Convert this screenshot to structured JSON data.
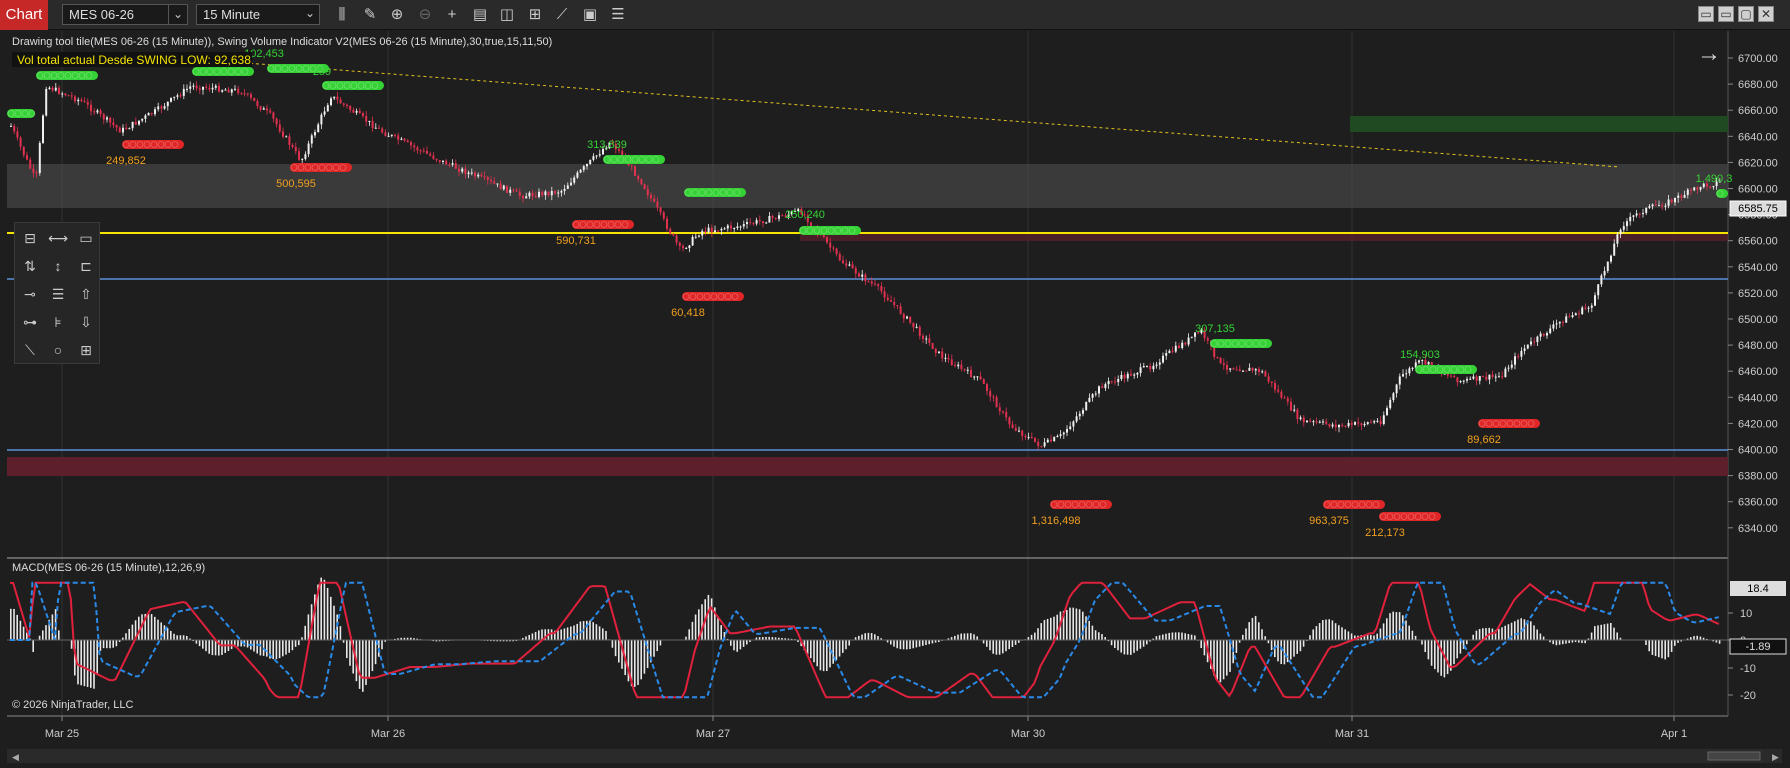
{
  "toolbar": {
    "chart_tab": "Chart",
    "instrument": "MES 06-26",
    "interval": "15 Minute",
    "window_buttons": [
      "▭",
      "▭",
      "▢",
      "✕"
    ]
  },
  "indicator_line": "Drawing tool tile(MES 06-26 (15 Minute)), Swing Volume Indicator V2(MES 06-26 (15 Minute),30,true,15,11,50)",
  "vol_label": "Vol total actual Desde SWING LOW: 92,638",
  "macd_title": "MACD(MES 06-26 (15 Minute),12,26,9)",
  "copyright": "© 2026 NinjaTrader, LLC",
  "price_axis": {
    "ticks": [
      "6700.00",
      "6680.00",
      "6660.00",
      "6640.00",
      "6620.00",
      "6600.00",
      "6580.00",
      "6560.00",
      "6540.00",
      "6520.00",
      "6500.00",
      "6480.00",
      "6460.00",
      "6440.00",
      "6420.00",
      "6400.00",
      "6380.00",
      "6360.00",
      "6340.00"
    ],
    "current_price": "6585.75"
  },
  "macd_axis": {
    "ticks": [
      "10",
      "0",
      "-10",
      "-20"
    ],
    "macd_value": "18.4",
    "hist_value": "-1.89"
  },
  "time_axis": [
    "Mar 25",
    "Mar 26",
    "Mar 27",
    "Mar 30",
    "Mar 31",
    "Apr 1"
  ],
  "swing_labels": {
    "highs": [
      "102,453",
      "259",
      "313,839",
      "250,240",
      "307,135",
      "154,903",
      "1,490,3"
    ],
    "lows": [
      "249,852",
      "500,595",
      "590,731",
      "60,418",
      "1,316,498",
      "963,375",
      "212,173",
      "89,662"
    ]
  },
  "colors": {
    "background": "#1e1e1e",
    "up_candle": "#f0f0f0",
    "down_candle": "#e0314f",
    "swing_high": "#35d235",
    "swing_low": "#e02626",
    "low_label": "#f0a020",
    "high_label": "#35d235",
    "yellow_line": "#f5e400",
    "blue_line": "#5b8fd8",
    "macd_line": "#e0213c",
    "signal_line": "#2a8ae8"
  }
}
